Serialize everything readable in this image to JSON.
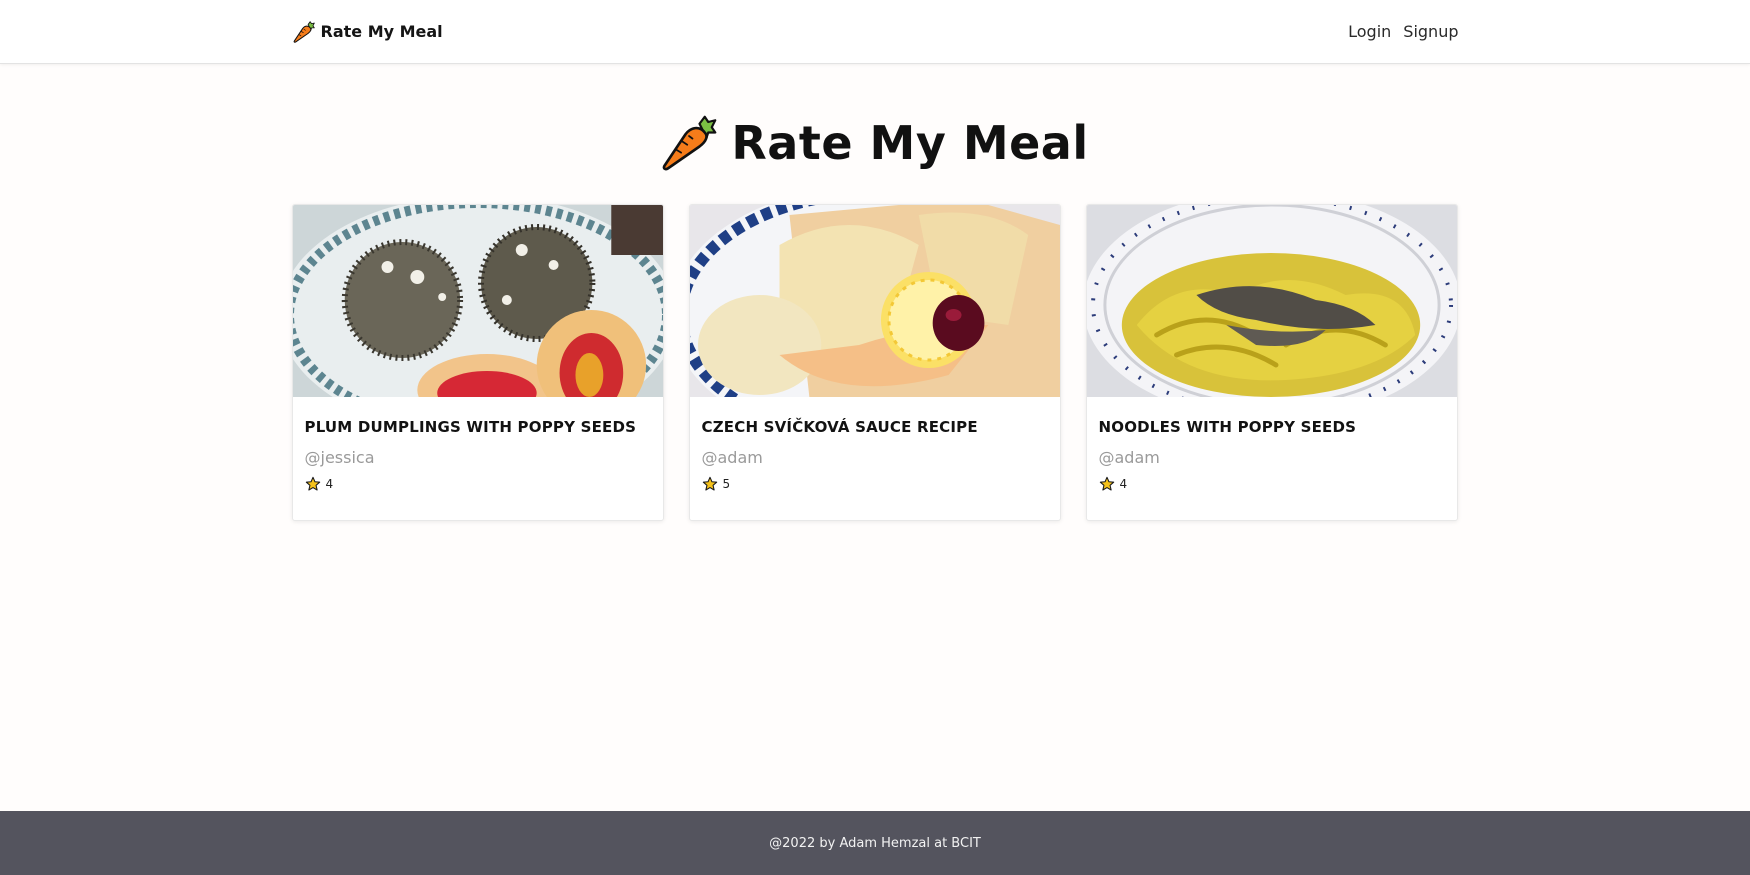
{
  "nav": {
    "brand_icon": "carrot-icon",
    "brand_label": "Rate My Meal",
    "login_label": "Login",
    "signup_label": "Signup"
  },
  "hero": {
    "icon": "carrot-icon",
    "title": "Rate My Meal"
  },
  "cards": [
    {
      "title": "PLUM DUMPLINGS WITH POPPY SEEDS",
      "user": "@jessica",
      "rating": "4",
      "image": "plum-dumplings-photo"
    },
    {
      "title": "CZECH SVÍČKOVÁ SAUCE RECIPE",
      "user": "@adam",
      "rating": "5",
      "image": "svickova-photo"
    },
    {
      "title": "NOODLES WITH POPPY SEEDS",
      "user": "@adam",
      "rating": "4",
      "image": "poppy-noodles-photo"
    }
  ],
  "footer": {
    "text": "@2022 by Adam Hemzal at BCIT"
  },
  "colors": {
    "footer_bg": "#54545e",
    "carrot": "#f57c1a",
    "star": "#f5c21b"
  }
}
